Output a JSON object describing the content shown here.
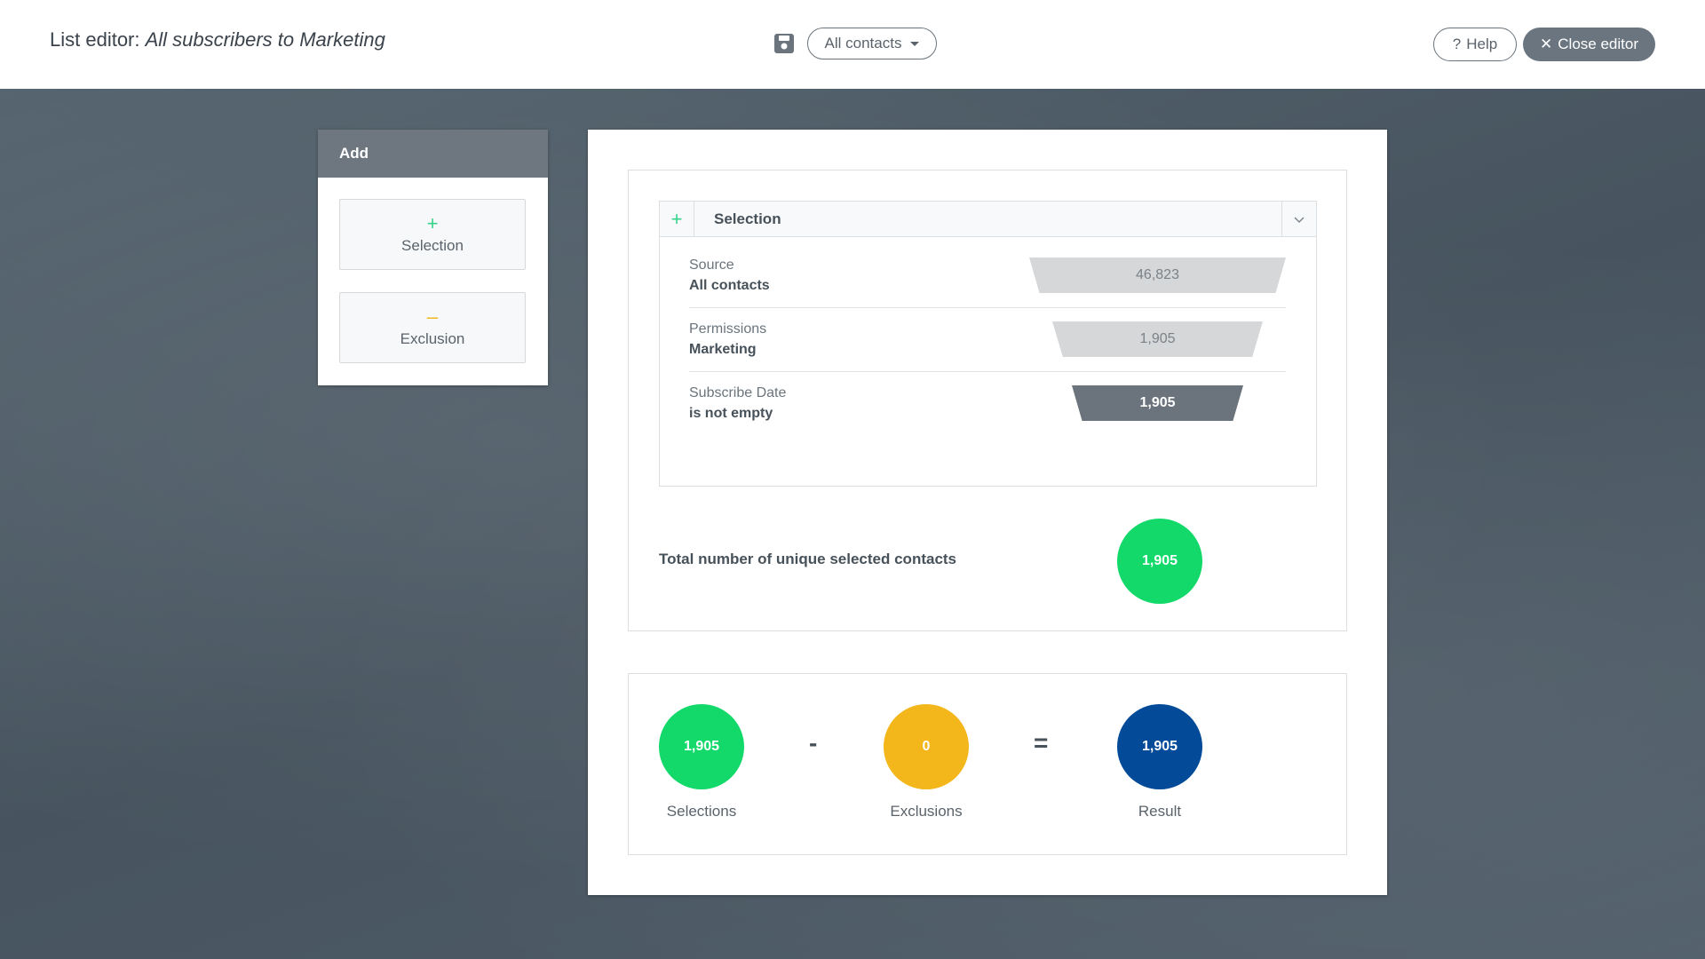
{
  "header": {
    "title_prefix": "List editor: ",
    "title_name": "All subscribers to Marketing",
    "dropdown_value": "All contacts",
    "help_label": "Help",
    "help_icon": "?",
    "close_label": "Close editor",
    "close_icon": "✕"
  },
  "add_panel": {
    "title": "Add",
    "selection_symbol": "+",
    "selection_label": "Selection",
    "exclusion_symbol": "–",
    "exclusion_label": "Exclusion"
  },
  "selection": {
    "title": "Selection",
    "plus_symbol": "+",
    "criteria": [
      {
        "key": "Source",
        "value": "All contacts",
        "count": "46,823"
      },
      {
        "key": "Permissions",
        "value": "Marketing",
        "count": "1,905"
      },
      {
        "key": "Subscribe Date",
        "value": "is not empty",
        "count": "1,905"
      }
    ]
  },
  "total": {
    "label": "Total number of unique selected contacts",
    "value": "1,905"
  },
  "summary": {
    "selections_value": "1,905",
    "selections_label": "Selections",
    "minus": "-",
    "exclusions_value": "0",
    "exclusions_label": "Exclusions",
    "equals": "=",
    "result_value": "1,905",
    "result_label": "Result"
  },
  "colors": {
    "green": "#12d96a",
    "yellow": "#f3b71b",
    "blue": "#034b99",
    "funnel_light": "#d6d7d8",
    "funnel_dark": "#6b737c"
  }
}
